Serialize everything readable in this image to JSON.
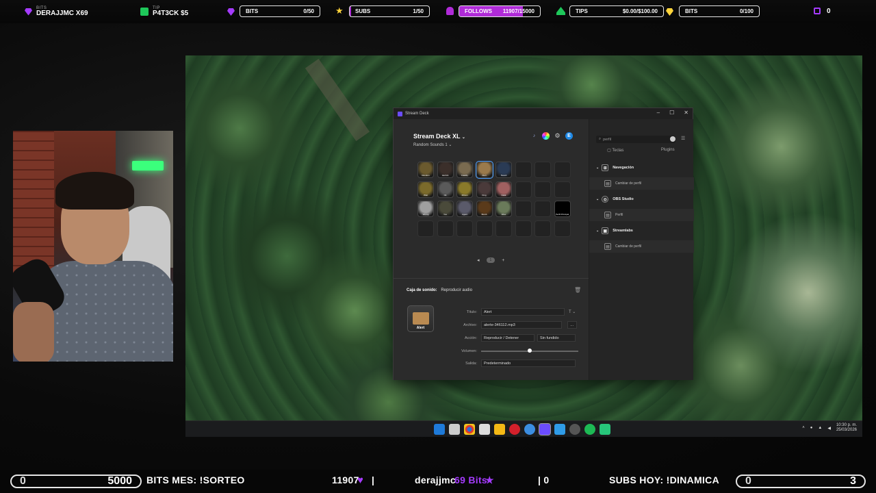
{
  "topbar": {
    "bits_label": "BITS",
    "bits_user": "DERAJJMC X69",
    "tip_label": "TIP",
    "tip_user": "P4T3CK $5",
    "goals": [
      {
        "label": "BITS",
        "value": "0/50",
        "progress": 0
      },
      {
        "label": "SUBS",
        "value": "1/50",
        "progress": 0.02
      },
      {
        "label": "FOLLOWS",
        "value": "11907/15000",
        "progress": 0.79
      },
      {
        "label": "TIPS",
        "value": "$0.00/$100.00",
        "progress": 0
      },
      {
        "label": "BITS",
        "value": "0/100",
        "progress": 0
      }
    ],
    "chat_count": "0",
    "accent": "#b02bd8"
  },
  "streamdeck": {
    "window_title": "Stream Deck",
    "device": "Stream Deck XL",
    "profile": "Random Sounds 1",
    "keys": [
      {
        "label": "Random"
      },
      {
        "label": "Herrick"
      },
      {
        "label": "Fatality"
      },
      {
        "label": "Alert",
        "selected": true
      },
      {
        "label": "Sword"
      },
      {
        "label": "Wait"
      },
      {
        "label": "Ok"
      },
      {
        "label": "Minion"
      },
      {
        "label": "King"
      },
      {
        "label": "Fatal"
      },
      {
        "label": "Wrong"
      },
      {
        "label": "Yes"
      },
      {
        "label": "Agent"
      },
      {
        "label": "Bomb"
      },
      {
        "label": "Wow"
      },
      {
        "label": "Perfil Principal"
      }
    ],
    "page_number": "1",
    "action_category": "Caja de sonido:",
    "action_name": "Reproducir audio",
    "preview_label": "Alert",
    "fields": {
      "title_label": "Título:",
      "title_value": "Alert",
      "file_label": "Archivo:",
      "file_value": "alerte-346112.mp3",
      "action_label": "Acción:",
      "action_value": "Reproducir / Detener",
      "fade_value": "Sin fundido",
      "volume_label": "Volumen:",
      "volume_level": 0.5,
      "output_label": "Salida:",
      "output_value": "Predeterminado"
    },
    "search_value": "perfil",
    "tabs": [
      "Teclas",
      "Plugins"
    ],
    "plugins": [
      {
        "category": "Navegación",
        "action": "Cambiar de perfil"
      },
      {
        "category": "OBS Studio",
        "action": "Perfil"
      },
      {
        "category": "Streamlabs",
        "action": "Cambiar de perfil"
      }
    ]
  },
  "taskbar": {
    "time": "10:30 p. m.",
    "date": "25/03/2026"
  },
  "bottombar": {
    "bits_min": "0",
    "bits_max": "5000",
    "bits_text": "BITS MES: !SORTEO",
    "follow_count": "11907",
    "divider": "|",
    "event_user": "derajjmc",
    "event_amount": "69 Bits",
    "subs_count": "| 0",
    "subs_text": "SUBS HOY: !DINAMICA",
    "subs_min": "0",
    "subs_max": "3"
  }
}
